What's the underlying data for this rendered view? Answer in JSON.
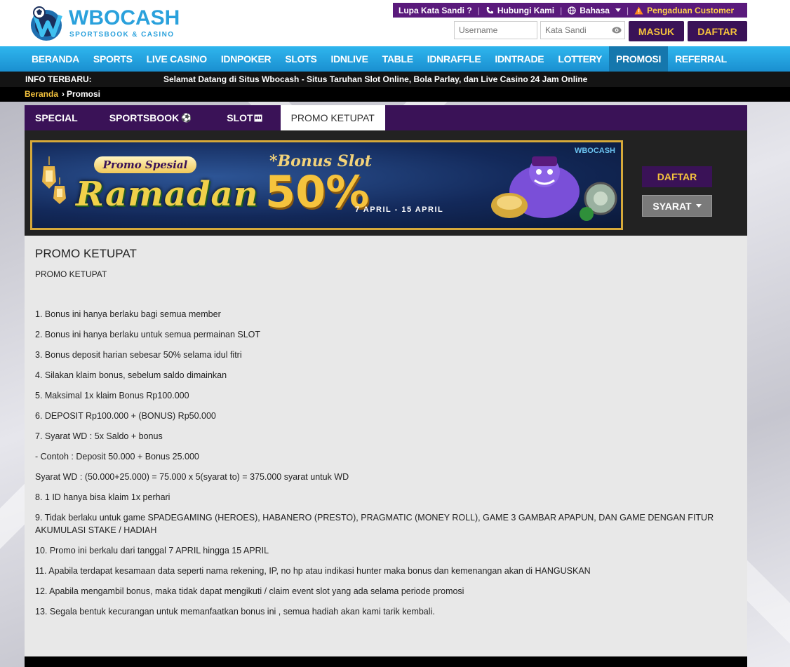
{
  "brand": {
    "name": "WBOCASH",
    "tagline": "SPORTSBOOK & CASINO"
  },
  "utility": {
    "forgot": "Lupa Kata Sandi ?",
    "contact": "Hubungi Kami",
    "language": "Bahasa",
    "complaint": "Pengaduan Customer"
  },
  "login": {
    "username_placeholder": "Username",
    "password_placeholder": "Kata Sandi",
    "login_label": "MASUK",
    "register_label": "DAFTAR"
  },
  "nav": {
    "items": [
      "BERANDA",
      "SPORTS",
      "LIVE CASINO",
      "IDNPOKER",
      "SLOTS",
      "IDNLIVE",
      "TABLE",
      "IDNRAFFLE",
      "IDNTRADE",
      "LOTTERY",
      "PROMOSI",
      "REFERRAL"
    ],
    "active": "PROMOSI"
  },
  "info": {
    "label": "INFO TERBARU:",
    "message": "Selamat Datang di Situs Wbocash - Situs Taruhan Slot Online, Bola Parlay, dan Live Casino 24 Jam Online"
  },
  "breadcrumb": {
    "home": "Beranda",
    "current": "Promosi"
  },
  "tabs": {
    "special": "SPECIAL",
    "sportsbook": "SPORTSBOOK",
    "slot": "SLOT",
    "ketupat": "PROMO KETUPAT"
  },
  "banner": {
    "spesial": "Promo Spesial",
    "ramadan": "Ramadan",
    "bonus": "*Bonus Slot",
    "percent": "50%",
    "dates": "7 APRIL - 15 APRIL",
    "logo": "WBOCASH"
  },
  "side": {
    "daftar": "DAFTAR",
    "syarat": "SYARAT"
  },
  "promo": {
    "title": "PROMO KETUPAT",
    "subtitle": "PROMO KETUPAT",
    "rules": [
      "1. Bonus ini hanya berlaku bagi semua member",
      "2. Bonus ini hanya berlaku untuk semua permainan SLOT",
      "3. Bonus deposit harian sebesar 50% selama idul fitri",
      "4. Silakan klaim bonus, sebelum saldo dimainkan",
      "5. Maksimal 1x klaim Bonus Rp100.000",
      "6. DEPOSIT Rp100.000 + (BONUS) Rp50.000",
      "7. Syarat WD : 5x Saldo + bonus",
      "- Contoh : Deposit 50.000 + Bonus 25.000",
      "Syarat WD : (50.000+25.000) = 75.000 x 5(syarat to) = 375.000 syarat untuk WD",
      "8. 1 ID hanya bisa klaim 1x perhari",
      "9. Tidak berlaku untuk game SPADEGAMING (HEROES), HABANERO (PRESTO), PRAGMATIC (MONEY ROLL), GAME 3 GAMBAR APAPUN, DAN GAME DENGAN FITUR AKUMULASI STAKE / HADIAH",
      "10. Promo ini berkalu dari tanggal 7 APRIL hingga 15 APRIL",
      "11. Apabila terdapat kesamaan data seperti nama rekening, IP, no hp atau indikasi hunter maka bonus dan kemenangan akan di HANGUSKAN",
      "12. Apabila mengambil bonus, maka tidak dapat mengikuti / claim event slot yang ada selama periode promosi",
      "13. Segala bentuk kecurangan untuk memanfaatkan bonus ini , semua hadiah akan kami tarik kembali."
    ]
  },
  "colors": {
    "purple": "#3a1257",
    "gold": "#f5c33d",
    "nav_blue": "#1a8fd0"
  }
}
